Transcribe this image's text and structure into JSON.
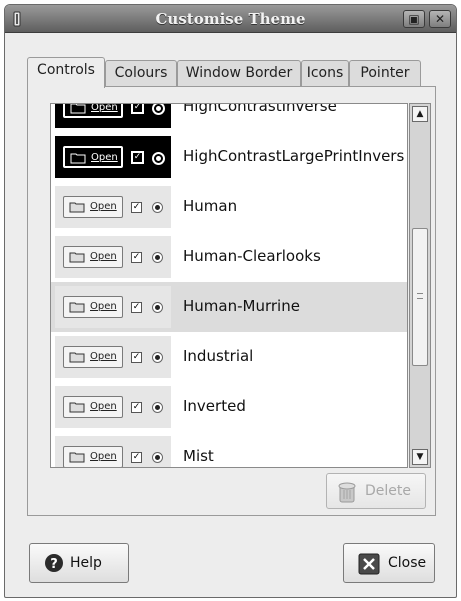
{
  "window": {
    "title": "Customise Theme",
    "minimize_symbol": "▣",
    "close_symbol": "✕"
  },
  "tabs": [
    {
      "label": "Controls",
      "active": true
    },
    {
      "label": "Colours",
      "active": false
    },
    {
      "label": "Window Border",
      "active": false
    },
    {
      "label": "Icons",
      "active": false
    },
    {
      "label": "Pointer",
      "active": false
    }
  ],
  "theme_list": {
    "preview_button_label": "Open",
    "rows": [
      {
        "name": "HighContrastInverse",
        "style": "dark",
        "selected": false
      },
      {
        "name": "HighContrastLargePrintInvers",
        "style": "dark",
        "selected": false
      },
      {
        "name": "Human",
        "style": "light",
        "selected": false
      },
      {
        "name": "Human-Clearlooks",
        "style": "light",
        "selected": false
      },
      {
        "name": "Human-Murrine",
        "style": "light",
        "selected": true
      },
      {
        "name": "Industrial",
        "style": "light",
        "selected": false
      },
      {
        "name": "Inverted",
        "style": "light",
        "selected": false
      },
      {
        "name": "Mist",
        "style": "light",
        "selected": false
      }
    ]
  },
  "buttons": {
    "delete_label": "Delete",
    "help_label": "Help",
    "close_label": "Close"
  },
  "colors": {
    "titlebar": "#7a7a7a",
    "selected_row": "#dcdcdc"
  }
}
